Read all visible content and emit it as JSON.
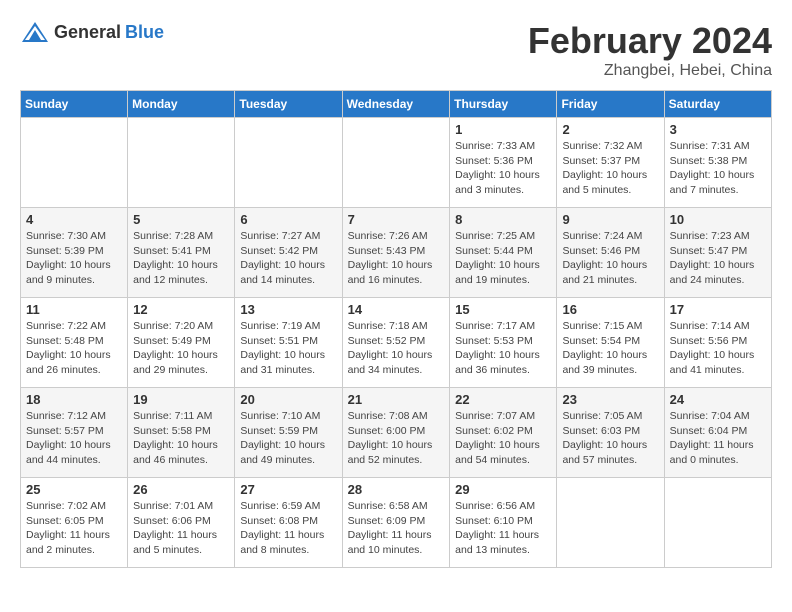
{
  "header": {
    "logo_general": "General",
    "logo_blue": "Blue",
    "month": "February 2024",
    "location": "Zhangbei, Hebei, China"
  },
  "weekdays": [
    "Sunday",
    "Monday",
    "Tuesday",
    "Wednesday",
    "Thursday",
    "Friday",
    "Saturday"
  ],
  "weeks": [
    [
      {
        "day": "",
        "info": ""
      },
      {
        "day": "",
        "info": ""
      },
      {
        "day": "",
        "info": ""
      },
      {
        "day": "",
        "info": ""
      },
      {
        "day": "1",
        "info": "Sunrise: 7:33 AM\nSunset: 5:36 PM\nDaylight: 10 hours\nand 3 minutes."
      },
      {
        "day": "2",
        "info": "Sunrise: 7:32 AM\nSunset: 5:37 PM\nDaylight: 10 hours\nand 5 minutes."
      },
      {
        "day": "3",
        "info": "Sunrise: 7:31 AM\nSunset: 5:38 PM\nDaylight: 10 hours\nand 7 minutes."
      }
    ],
    [
      {
        "day": "4",
        "info": "Sunrise: 7:30 AM\nSunset: 5:39 PM\nDaylight: 10 hours\nand 9 minutes."
      },
      {
        "day": "5",
        "info": "Sunrise: 7:28 AM\nSunset: 5:41 PM\nDaylight: 10 hours\nand 12 minutes."
      },
      {
        "day": "6",
        "info": "Sunrise: 7:27 AM\nSunset: 5:42 PM\nDaylight: 10 hours\nand 14 minutes."
      },
      {
        "day": "7",
        "info": "Sunrise: 7:26 AM\nSunset: 5:43 PM\nDaylight: 10 hours\nand 16 minutes."
      },
      {
        "day": "8",
        "info": "Sunrise: 7:25 AM\nSunset: 5:44 PM\nDaylight: 10 hours\nand 19 minutes."
      },
      {
        "day": "9",
        "info": "Sunrise: 7:24 AM\nSunset: 5:46 PM\nDaylight: 10 hours\nand 21 minutes."
      },
      {
        "day": "10",
        "info": "Sunrise: 7:23 AM\nSunset: 5:47 PM\nDaylight: 10 hours\nand 24 minutes."
      }
    ],
    [
      {
        "day": "11",
        "info": "Sunrise: 7:22 AM\nSunset: 5:48 PM\nDaylight: 10 hours\nand 26 minutes."
      },
      {
        "day": "12",
        "info": "Sunrise: 7:20 AM\nSunset: 5:49 PM\nDaylight: 10 hours\nand 29 minutes."
      },
      {
        "day": "13",
        "info": "Sunrise: 7:19 AM\nSunset: 5:51 PM\nDaylight: 10 hours\nand 31 minutes."
      },
      {
        "day": "14",
        "info": "Sunrise: 7:18 AM\nSunset: 5:52 PM\nDaylight: 10 hours\nand 34 minutes."
      },
      {
        "day": "15",
        "info": "Sunrise: 7:17 AM\nSunset: 5:53 PM\nDaylight: 10 hours\nand 36 minutes."
      },
      {
        "day": "16",
        "info": "Sunrise: 7:15 AM\nSunset: 5:54 PM\nDaylight: 10 hours\nand 39 minutes."
      },
      {
        "day": "17",
        "info": "Sunrise: 7:14 AM\nSunset: 5:56 PM\nDaylight: 10 hours\nand 41 minutes."
      }
    ],
    [
      {
        "day": "18",
        "info": "Sunrise: 7:12 AM\nSunset: 5:57 PM\nDaylight: 10 hours\nand 44 minutes."
      },
      {
        "day": "19",
        "info": "Sunrise: 7:11 AM\nSunset: 5:58 PM\nDaylight: 10 hours\nand 46 minutes."
      },
      {
        "day": "20",
        "info": "Sunrise: 7:10 AM\nSunset: 5:59 PM\nDaylight: 10 hours\nand 49 minutes."
      },
      {
        "day": "21",
        "info": "Sunrise: 7:08 AM\nSunset: 6:00 PM\nDaylight: 10 hours\nand 52 minutes."
      },
      {
        "day": "22",
        "info": "Sunrise: 7:07 AM\nSunset: 6:02 PM\nDaylight: 10 hours\nand 54 minutes."
      },
      {
        "day": "23",
        "info": "Sunrise: 7:05 AM\nSunset: 6:03 PM\nDaylight: 10 hours\nand 57 minutes."
      },
      {
        "day": "24",
        "info": "Sunrise: 7:04 AM\nSunset: 6:04 PM\nDaylight: 11 hours\nand 0 minutes."
      }
    ],
    [
      {
        "day": "25",
        "info": "Sunrise: 7:02 AM\nSunset: 6:05 PM\nDaylight: 11 hours\nand 2 minutes."
      },
      {
        "day": "26",
        "info": "Sunrise: 7:01 AM\nSunset: 6:06 PM\nDaylight: 11 hours\nand 5 minutes."
      },
      {
        "day": "27",
        "info": "Sunrise: 6:59 AM\nSunset: 6:08 PM\nDaylight: 11 hours\nand 8 minutes."
      },
      {
        "day": "28",
        "info": "Sunrise: 6:58 AM\nSunset: 6:09 PM\nDaylight: 11 hours\nand 10 minutes."
      },
      {
        "day": "29",
        "info": "Sunrise: 6:56 AM\nSunset: 6:10 PM\nDaylight: 11 hours\nand 13 minutes."
      },
      {
        "day": "",
        "info": ""
      },
      {
        "day": "",
        "info": ""
      }
    ]
  ]
}
